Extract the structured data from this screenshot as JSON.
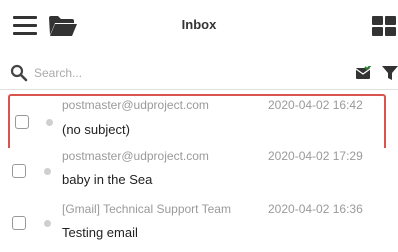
{
  "header": {
    "title": "Inbox",
    "menu_icon": "hamburger-menu-icon",
    "folder_icon": "folder-open-icon",
    "layout_icon": "grid-layout-icon"
  },
  "search": {
    "placeholder": "Search...",
    "search_icon": "magnifier-icon",
    "mark_read_icon": "mail-check-icon",
    "filter_icon": "filter-icon"
  },
  "emails": [
    {
      "sender": "postmaster@udproject.com",
      "date": "2020-04-02 16:42",
      "subject": "(no subject)",
      "selected": true
    },
    {
      "sender": "postmaster@udproject.com",
      "date": "2020-04-02 17:29",
      "subject": "baby in the Sea",
      "selected": false
    },
    {
      "sender": "[Gmail] Technical Support Team",
      "date": "2020-04-02 16:36",
      "subject": "Testing email",
      "selected": false
    }
  ],
  "colors": {
    "highlight_border": "#d9534f",
    "icon": "#333333",
    "muted_text": "#9a9a9a"
  }
}
